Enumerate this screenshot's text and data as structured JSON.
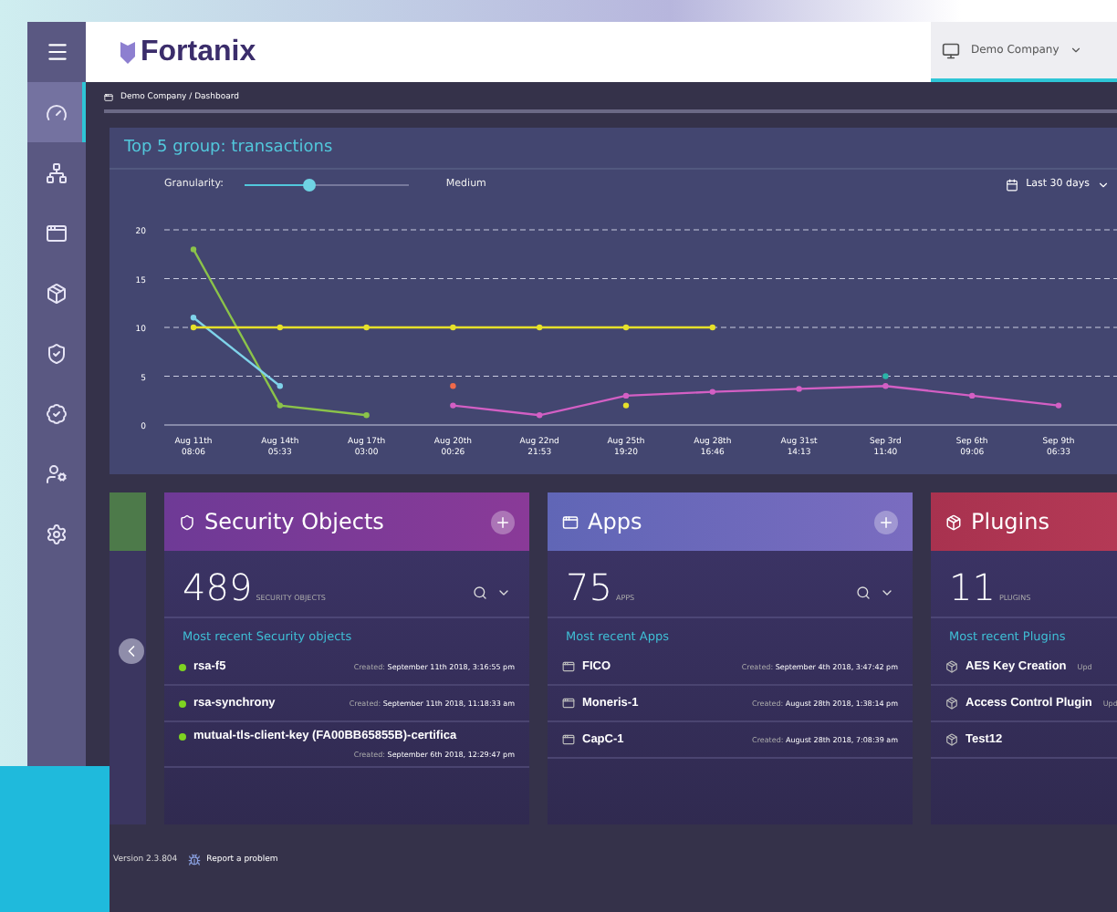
{
  "header": {
    "logo": "Fortanix",
    "account": "Demo Company"
  },
  "sidebar": {
    "items": [
      {
        "selected": true
      },
      {
        "selected": false
      },
      {
        "selected": false
      },
      {
        "selected": false
      },
      {
        "selected": false
      },
      {
        "selected": false
      },
      {
        "selected": false
      },
      {
        "selected": false
      }
    ]
  },
  "breadcrumb": "Demo Company / Dashboard",
  "chart_panel": {
    "title": "Top 5 group: transactions",
    "granularity_label": "Granularity:",
    "granularity": {
      "level": 0.38
    },
    "granularity_value": "Medium",
    "range": "Last 30 days",
    "chart_data": {
      "type": "line",
      "grid": true,
      "categories": [
        "Aug 11th\n08:06",
        "Aug 14th\n05:33",
        "Aug 17th\n03:00",
        "Aug 20th\n00:26",
        "Aug 22nd\n21:53",
        "Aug 25th\n19:20",
        "Aug 28th\n16:46",
        "Aug 31st\n14:13",
        "Sep 3rd\n11:40",
        "Sep 6th\n09:06",
        "Sep 9th\n06:33"
      ],
      "ylim": [
        0,
        20
      ],
      "yticks": [
        0,
        5,
        10,
        15,
        20
      ],
      "series": [
        {
          "marker": true,
          "color": "#8bc34a",
          "values": [
            18,
            2,
            1,
            null,
            null,
            null,
            null,
            null,
            null,
            null,
            null
          ]
        },
        {
          "marker": true,
          "color": "#7fd3ea",
          "values": [
            11,
            4,
            null,
            null,
            null,
            null,
            null,
            null,
            null,
            null,
            null
          ]
        },
        {
          "marker": true,
          "color": "#e6e02a",
          "values": [
            10,
            10,
            10,
            10,
            10,
            10,
            10,
            null,
            null,
            null,
            null
          ]
        },
        {
          "marker": true,
          "color": "#d35fc4",
          "values": [
            null,
            null,
            null,
            2,
            1,
            3,
            3.4,
            3.7,
            4,
            3,
            2
          ]
        },
        {
          "marker": true,
          "color": "#f06a4a",
          "values": [
            null,
            null,
            null,
            4,
            null,
            null,
            null,
            null,
            null,
            null,
            null
          ]
        },
        {
          "marker": true,
          "color": "#e6e02a",
          "values": [
            null,
            null,
            null,
            null,
            null,
            2,
            null,
            null,
            null,
            null,
            null
          ]
        },
        {
          "marker": true,
          "color": "#2bb5a8",
          "values": [
            null,
            null,
            null,
            null,
            null,
            null,
            null,
            null,
            5,
            null,
            null
          ]
        }
      ]
    }
  },
  "cards": [
    {
      "kind": "security",
      "title": "Security Objects",
      "count": "489",
      "count_label": "SECURITY OBJECTS",
      "recent": "Most recent Security objects",
      "items": [
        {
          "name": "rsa-f5",
          "created_label": "Created:",
          "date": "September 11th 2018, 3:16:55 pm"
        },
        {
          "name": "rsa-synchrony",
          "created_label": "Created:",
          "date": "September 11th 2018, 11:18:33 am"
        },
        {
          "name": "mutual-tls-client-key (FA00BB65855B)-certifica",
          "created_label": "Created:",
          "date": "September 6th 2018, 12:29:47 pm"
        }
      ]
    },
    {
      "kind": "apps",
      "title": "Apps",
      "count": "75",
      "count_label": "APPS",
      "recent": "Most recent Apps",
      "items": [
        {
          "name": "FICO",
          "created_label": "Created:",
          "date": "September 4th 2018, 3:47:42 pm"
        },
        {
          "name": "Moneris-1",
          "created_label": "Created:",
          "date": "August 28th 2018, 1:38:14 pm"
        },
        {
          "name": "CapC-1",
          "created_label": "Created:",
          "date": "August 28th 2018, 7:08:39 am"
        }
      ]
    },
    {
      "kind": "plugins",
      "title": "Plugins",
      "count": "11",
      "count_label": "PLUGINS",
      "recent": "Most recent Plugins",
      "items": [
        {
          "name": "AES Key Creation",
          "created_label": "Upd"
        },
        {
          "name": "Access Control Plugin",
          "created_label": "Upd"
        },
        {
          "name": "Test12"
        }
      ]
    }
  ],
  "footer": {
    "version": "Version 2.3.804",
    "report": "Report a problem"
  }
}
